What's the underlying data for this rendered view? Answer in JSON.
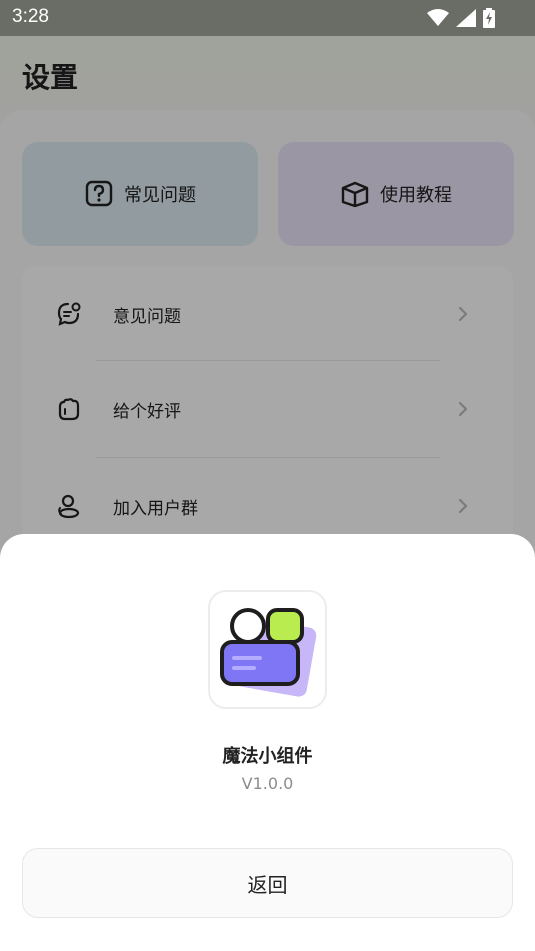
{
  "status_bar": {
    "time": "3:28",
    "icons": [
      "wifi-icon",
      "signal-icon",
      "battery-charging-icon"
    ]
  },
  "page": {
    "title": "设置",
    "quick_actions": [
      {
        "label": "常见问题",
        "icon": "question-box-icon",
        "color": "#dcebf3"
      },
      {
        "label": "使用教程",
        "icon": "cube-box-icon",
        "color": "#ebe4f7"
      }
    ],
    "menu_items": [
      {
        "label": "意见问题",
        "icon": "feedback-chat-icon"
      },
      {
        "label": "给个好评",
        "icon": "thumbs-up-icon"
      },
      {
        "label": "加入用户群",
        "icon": "user-group-icon"
      }
    ]
  },
  "about_sheet": {
    "app_name": "魔法小组件",
    "version": "V1.0.0",
    "back_label": "返回",
    "icon_colors": {
      "purple": "#7f76f5",
      "lime": "#b9ec4f",
      "lilac": "#c7b6f8"
    }
  }
}
